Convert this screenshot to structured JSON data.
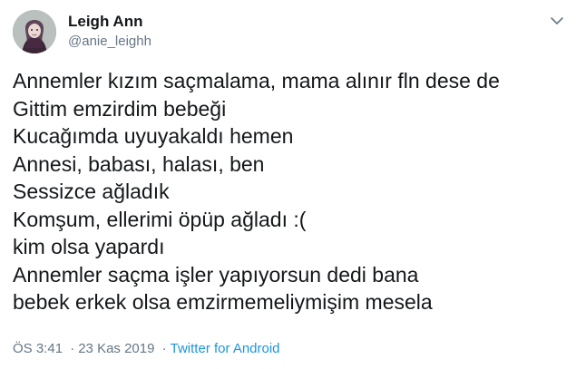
{
  "user": {
    "display_name": "Leigh Ann",
    "handle": "@anie_leighh"
  },
  "tweet": {
    "lines": [
      "Annemler kızım saçmalama, mama alınır fln dese de",
      "Gittim emzirdim bebeği",
      "Kucağımda uyuyakaldı hemen",
      "Annesi, babası, halası, ben",
      "Sessizce ağladık",
      "Komşum, ellerimi öpüp ağladı :(",
      "kim olsa yapardı",
      "Annemler saçma işler yapıyorsun dedi bana",
      "bebek erkek olsa emzirmemeliymişim mesela"
    ]
  },
  "meta": {
    "time": "ÖS 3:41",
    "separator": "·",
    "date": "23 Kas 2019",
    "source": "Twitter for Android"
  },
  "icons": {
    "menu": "chevron-down-icon"
  },
  "colors": {
    "text": "#14171a",
    "secondary": "#657786",
    "link": "#1b95e0"
  }
}
